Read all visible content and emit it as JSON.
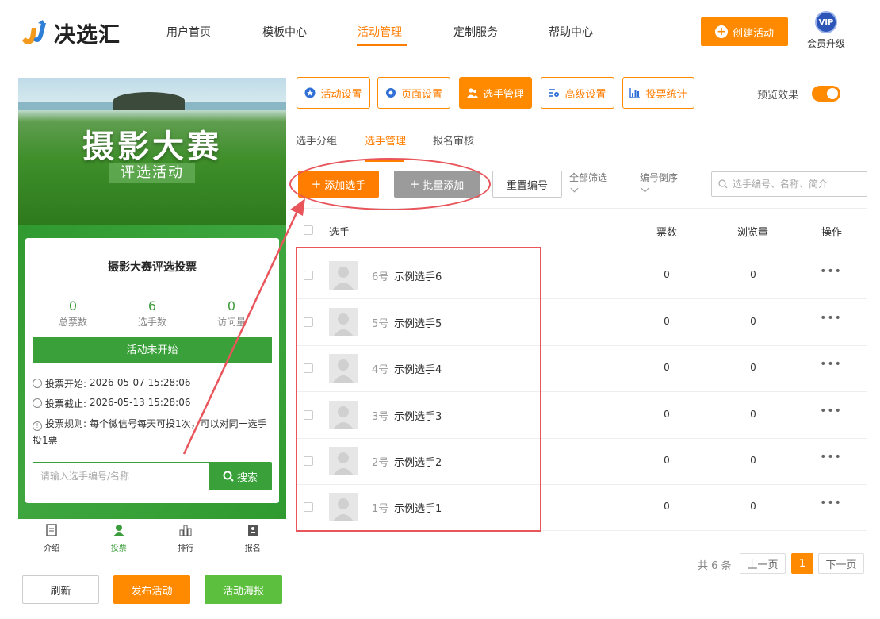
{
  "header": {
    "logo_text": "决选汇",
    "nav": [
      {
        "label": "用户首页"
      },
      {
        "label": "模板中心"
      },
      {
        "label": "活动管理",
        "active": true
      },
      {
        "label": "定制服务"
      },
      {
        "label": "帮助中心"
      }
    ],
    "create_button": "创建活动",
    "vip_badge": "VIP",
    "vip_label": "会员升级"
  },
  "preview": {
    "banner_title": "摄影大赛",
    "banner_subtitle": "评选活动",
    "card_title": "摄影大赛评选投票",
    "stats": [
      {
        "value": "0",
        "label": "总票数"
      },
      {
        "value": "6",
        "label": "选手数"
      },
      {
        "value": "0",
        "label": "访问量"
      }
    ],
    "status": "活动未开始",
    "vote_start_label": "投票开始:",
    "vote_start": "2026-05-07 15:28:06",
    "vote_end_label": "投票截止:",
    "vote_end": "2026-05-13 15:28:06",
    "rule_label": "投票规则:",
    "rule_text": "每个微信号每天可投1次，可以对同一选手投1票",
    "search_placeholder": "请输入选手编号/名称",
    "search_button": "搜索",
    "tabbar": [
      {
        "label": "介绍",
        "icon": "intro-icon"
      },
      {
        "label": "投票",
        "icon": "vote-icon",
        "active": true
      },
      {
        "label": "排行",
        "icon": "rank-icon"
      },
      {
        "label": "报名",
        "icon": "signup-icon"
      }
    ]
  },
  "bottom_buttons": {
    "refresh": "刷新",
    "publish": "发布活动",
    "poster": "活动海报"
  },
  "toolbar": {
    "buttons": [
      {
        "label": "活动设置",
        "icon": "settings-star-icon"
      },
      {
        "label": "页面设置",
        "icon": "gear-icon"
      },
      {
        "label": "选手管理",
        "icon": "users-icon",
        "active": true
      },
      {
        "label": "高级设置",
        "icon": "advanced-gear-icon"
      },
      {
        "label": "投票统计",
        "icon": "bar-chart-icon"
      }
    ],
    "preview_label": "预览效果",
    "preview_on": true
  },
  "subtabs": [
    {
      "label": "选手分组"
    },
    {
      "label": "选手管理",
      "active": true
    },
    {
      "label": "报名审核"
    }
  ],
  "actions": {
    "add": "添加选手",
    "batch": "批量添加",
    "reset": "重置编号",
    "filter": "全部筛选",
    "sort": "编号倒序",
    "search_placeholder": "选手编号、名称、简介"
  },
  "table": {
    "columns": {
      "player": "选手",
      "votes": "票数",
      "views": "浏览量",
      "ops": "操作"
    },
    "rows": [
      {
        "num": "6号",
        "name": "示例选手6",
        "votes": "0",
        "views": "0"
      },
      {
        "num": "5号",
        "name": "示例选手5",
        "votes": "0",
        "views": "0"
      },
      {
        "num": "4号",
        "name": "示例选手4",
        "votes": "0",
        "views": "0"
      },
      {
        "num": "3号",
        "name": "示例选手3",
        "votes": "0",
        "views": "0"
      },
      {
        "num": "2号",
        "name": "示例选手2",
        "votes": "0",
        "views": "0"
      },
      {
        "num": "1号",
        "name": "示例选手1",
        "votes": "0",
        "views": "0"
      }
    ],
    "more_symbol": "•••"
  },
  "pagination": {
    "total": "共 6 条",
    "prev": "上一页",
    "current": "1",
    "next": "下一页"
  },
  "colors": {
    "accent": "#ff8a00",
    "green": "#3aa13a",
    "annotation": "#e8555b"
  }
}
